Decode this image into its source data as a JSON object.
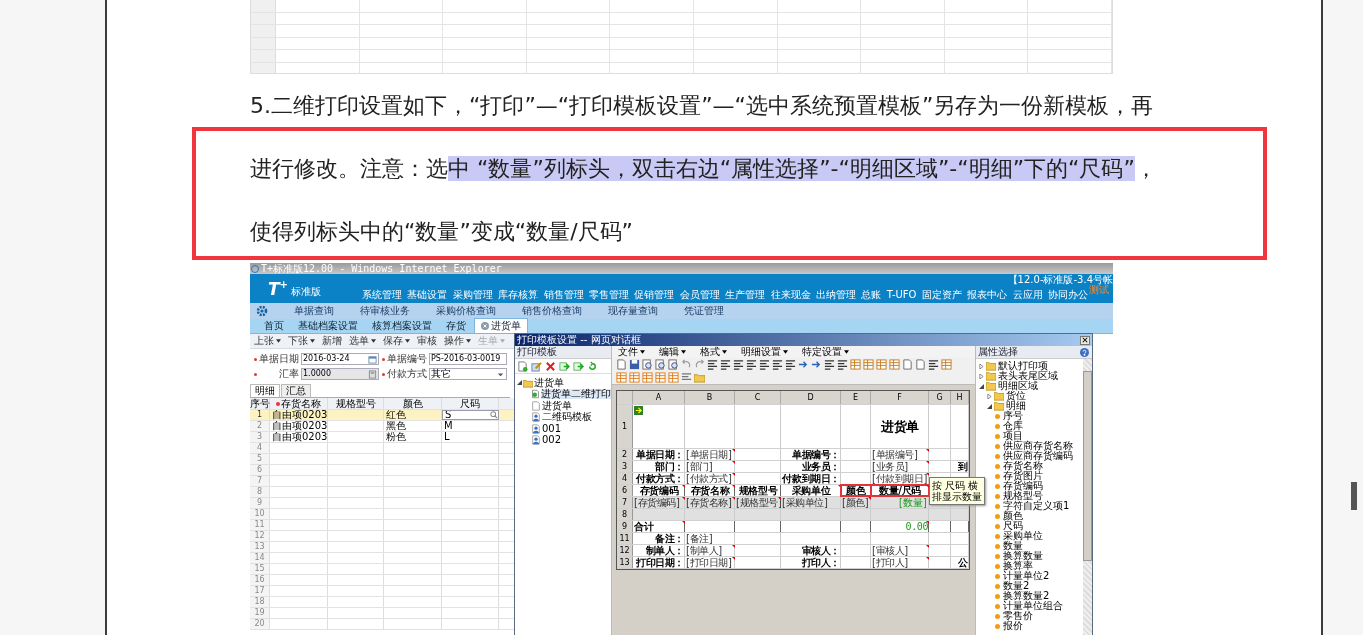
{
  "article": {
    "paragraph_lines": [
      [
        {
          "text": "5.二维打印设置如下，“打印”—“打印模板设置”—“选中系统预置模板”另存为一份新模板，再",
          "highlighted": false
        }
      ],
      [
        {
          "text": "进行修改。注意：选",
          "highlighted": false
        },
        {
          "text": "中 “数量”列标头，双击右边“属性选择”-“明细区域”-“明细”下的“尺码”",
          "highlighted": true
        },
        {
          "text": "，",
          "highlighted": false
        }
      ],
      [
        {
          "text": "使得列标头中的“数量”变成“数量/尺码”",
          "highlighted": false
        }
      ]
    ]
  },
  "screenshot": {
    "window_title": "T+标准版12.00 - Windows Internet Explorer",
    "logo": {
      "mark": "T$^{+}$",
      "edition": "标准版"
    },
    "account": "【12.0-标准版-3.4号帐",
    "nav": [
      {
        "label": "系统管理"
      },
      {
        "label": "基础设置"
      },
      {
        "label": "采购管理"
      },
      {
        "label": "库存核算"
      },
      {
        "label": "销售管理"
      },
      {
        "label": "零售管理"
      },
      {
        "label": "促销管理"
      },
      {
        "label": "会员管理"
      },
      {
        "label": "生产管理"
      },
      {
        "label": "往来现金"
      },
      {
        "label": "出纳管理"
      },
      {
        "label": "总账"
      },
      {
        "label": "T-UFO"
      },
      {
        "label": "固定资产"
      },
      {
        "label": "报表中心"
      },
      {
        "label": "云应用"
      },
      {
        "label": "协同办公",
        "badge": "测试"
      }
    ],
    "subnav": [
      "单据查询",
      "待审核业务",
      "采购价格查询",
      "销售价格查询",
      "现存量查询",
      "凭证管理"
    ],
    "tabs": [
      {
        "label": "首页",
        "selected": false,
        "closable": false
      },
      {
        "label": "基础档案设置",
        "selected": false,
        "closable": false
      },
      {
        "label": "核算档案设置",
        "selected": false,
        "closable": false
      },
      {
        "label": "存货",
        "selected": false,
        "closable": false
      },
      {
        "label": "进货单",
        "selected": true,
        "closable": true
      }
    ],
    "toolbar": [
      {
        "label": "上张",
        "dropdown": true,
        "disabled": false
      },
      {
        "label": "下张",
        "dropdown": true,
        "disabled": false
      },
      {
        "label": "新增",
        "dropdown": false,
        "disabled": false
      },
      {
        "label": "选单",
        "dropdown": true,
        "disabled": false
      },
      {
        "label": "保存",
        "dropdown": true,
        "disabled": false
      },
      {
        "label": "审核",
        "dropdown": false,
        "disabled": false
      },
      {
        "label": "操作",
        "dropdown": true,
        "disabled": false
      },
      {
        "label": "生单",
        "dropdown": true,
        "disabled": true
      }
    ],
    "form": [
      {
        "label": "单据日期",
        "value": "2016-03-24",
        "kind": "date",
        "required": true,
        "disabled": false
      },
      {
        "label": "单据编号",
        "value": "PS-2016-03-0019",
        "kind": "text",
        "required": true,
        "disabled": false
      },
      {
        "label": "汇率",
        "value": "1.0000",
        "kind": "calc",
        "required": true,
        "disabled": true
      },
      {
        "label": "付款方式",
        "value": "其它",
        "kind": "select",
        "required": true,
        "disabled": false
      }
    ],
    "detail_tabs": [
      {
        "label": "明细",
        "selected": true
      },
      {
        "label": "汇总",
        "selected": false
      }
    ],
    "table": {
      "columns": [
        {
          "label": "序号",
          "required": false
        },
        {
          "label": "存货名称",
          "required": true
        },
        {
          "label": "规格型号",
          "required": false
        },
        {
          "label": "颜色",
          "required": false
        },
        {
          "label": "尺码",
          "required": false
        }
      ],
      "rows": [
        {
          "cells": [
            "1",
            "自由项0203",
            null,
            "红色",
            "S"
          ],
          "selected": true
        },
        {
          "cells": [
            "2",
            "自由项0203",
            null,
            "黑色",
            "M"
          ],
          "selected": false
        },
        {
          "cells": [
            "3",
            "自由项0203",
            null,
            "粉色",
            "L"
          ],
          "selected": false
        },
        {
          "cells": [
            "4",
            null,
            null,
            null,
            null
          ],
          "selected": false
        },
        {
          "cells": [
            "5",
            null,
            null,
            null,
            null
          ],
          "selected": false
        },
        {
          "cells": [
            "6",
            null,
            null,
            null,
            null
          ],
          "selected": false
        },
        {
          "cells": [
            "7",
            null,
            null,
            null,
            null
          ],
          "selected": false
        },
        {
          "cells": [
            "8",
            null,
            null,
            null,
            null
          ],
          "selected": false
        },
        {
          "cells": [
            "9",
            null,
            null,
            null,
            null
          ],
          "selected": false
        },
        {
          "cells": [
            "10",
            null,
            null,
            null,
            null
          ],
          "selected": false
        },
        {
          "cells": [
            "11",
            null,
            null,
            null,
            null
          ],
          "selected": false
        },
        {
          "cells": [
            "12",
            null,
            null,
            null,
            null
          ],
          "selected": false
        },
        {
          "cells": [
            "13",
            null,
            null,
            null,
            null
          ],
          "selected": false
        },
        {
          "cells": [
            "14",
            null,
            null,
            null,
            null
          ],
          "selected": false
        },
        {
          "cells": [
            "15",
            null,
            null,
            null,
            null
          ],
          "selected": false
        },
        {
          "cells": [
            "16",
            null,
            null,
            null,
            null
          ],
          "selected": false
        },
        {
          "cells": [
            "17",
            null,
            null,
            null,
            null
          ],
          "selected": false
        },
        {
          "cells": [
            "18",
            null,
            null,
            null,
            null
          ],
          "selected": false
        },
        {
          "cells": [
            "19",
            null,
            null,
            null,
            null
          ],
          "selected": false
        },
        {
          "cells": [
            "20",
            null,
            null,
            null,
            null
          ],
          "selected": false
        }
      ]
    },
    "dialog": {
      "title": "打印模板设置 -- 网页对话框",
      "templates": {
        "title": "打印模板",
        "tree": [
          {
            "label": "进货单",
            "kind": "folder",
            "selected": false,
            "children": [
              {
                "label": "进货单二维打印",
                "kind": "default",
                "selected": true
              },
              {
                "label": "进货单",
                "kind": "blank",
                "selected": false
              },
              {
                "label": "二维码模板",
                "kind": "custom",
                "selected": false
              },
              {
                "label": "001",
                "kind": "custom",
                "selected": false
              },
              {
                "label": "002",
                "kind": "custom",
                "selected": false
              }
            ]
          }
        ]
      },
      "menu": [
        "文件",
        "编辑",
        "格式",
        "明细设置",
        "特定设置"
      ],
      "sheet": {
        "columns": [
          "A",
          "B",
          "C",
          "D",
          "E",
          "F",
          "G",
          "H"
        ],
        "rows": [
          {
            "number": "1",
            "kind": "title",
            "cells": [
              null,
              null,
              null,
              null,
              null,
              {
                "text": "进货单",
                "kind": "title",
                "flag": false
              }
            ]
          },
          {
            "number": "2",
            "kind": "field",
            "cells": [
              {
                "text": "单据日期：",
                "kind": "label",
                "flag": false
              },
              {
                "text": "[单据日期]",
                "kind": "field",
                "flag": true
              },
              null,
              {
                "text": "单据编号：",
                "kind": "label",
                "flag": false
              },
              null,
              {
                "text": "[单据编号]",
                "kind": "field",
                "flag": true
              }
            ]
          },
          {
            "number": "3",
            "kind": "field",
            "cells": [
              {
                "text": "部门：",
                "kind": "label",
                "flag": false
              },
              {
                "text": "[部门]",
                "kind": "field",
                "flag": true
              },
              null,
              {
                "text": "业务员：",
                "kind": "label",
                "flag": false
              },
              null,
              {
                "text": "[业务员]",
                "kind": "field",
                "flag": true
              },
              null,
              {
                "text": "到",
                "kind": "label",
                "flag": false
              }
            ]
          },
          {
            "number": "4",
            "kind": "field",
            "cells": [
              {
                "text": "付款方式：",
                "kind": "label",
                "flag": false
              },
              {
                "text": "[付款方式]",
                "kind": "field",
                "flag": true
              },
              null,
              {
                "text": "付款到期日：",
                "kind": "label",
                "flag": false
              },
              null,
              {
                "text": "[付款到期日]",
                "kind": "field",
                "flag": true
              }
            ]
          },
          {
            "number": "6",
            "kind": "header",
            "cells": [
              {
                "text": "存货编码",
                "kind": "heading",
                "flag": true,
                "outlined": false
              },
              {
                "text": "存货名称",
                "kind": "heading",
                "flag": true,
                "outlined": false
              },
              {
                "text": "规格型号",
                "kind": "heading",
                "flag": false,
                "outlined": false
              },
              {
                "text": "采购单位",
                "kind": "heading",
                "flag": true,
                "outlined": false
              },
              {
                "text": "颜色",
                "kind": "heading",
                "flag": false,
                "outlined": true
              },
              {
                "text": "数量/尺码",
                "kind": "heading",
                "flag": true,
                "outlined": true
              }
            ]
          },
          {
            "number": "7",
            "kind": "data",
            "cells": [
              {
                "text": "[存货编码]",
                "kind": "field",
                "flag": true
              },
              {
                "text": "[存货名称]",
                "kind": "field",
                "flag": true
              },
              {
                "text": "[规格型号]",
                "kind": "field",
                "flag": true
              },
              {
                "text": "[采购单位]",
                "kind": "field",
                "flag": false
              },
              {
                "text": "[颜色]",
                "kind": "field",
                "flag": true
              },
              {
                "text": "[数量]",
                "kind": "amount",
                "flag": false
              }
            ]
          },
          {
            "number": "8",
            "kind": "blank"
          },
          {
            "number": "9",
            "kind": "total",
            "cells": [
              {
                "text": "合计",
                "kind": "text",
                "flag": true
              },
              null,
              null,
              null,
              null,
              {
                "text": "0.00",
                "kind": "amount",
                "flag": true
              }
            ]
          },
          {
            "number": "11",
            "kind": "field",
            "cells": [
              {
                "text": "备注：",
                "kind": "label",
                "flag": false
              },
              {
                "text": "[备注]",
                "kind": "field",
                "flag": false
              }
            ]
          },
          {
            "number": "12",
            "kind": "field",
            "cells": [
              {
                "text": "制单人：",
                "kind": "label",
                "flag": false
              },
              {
                "text": "[制单人]",
                "kind": "field",
                "flag": true
              },
              null,
              {
                "text": "审核人：",
                "kind": "label",
                "flag": false
              },
              null,
              {
                "text": "[审核人]",
                "kind": "field",
                "flag": true
              }
            ]
          },
          {
            "number": "13",
            "kind": "field",
            "cells": [
              {
                "text": "打印日期：",
                "kind": "label",
                "flag": false
              },
              {
                "text": "[打印日期]",
                "kind": "field",
                "flag": true
              },
              null,
              {
                "text": "打印人：",
                "kind": "label",
                "flag": false
              },
              null,
              {
                "text": "[打印人]",
                "kind": "field",
                "flag": true
              },
              null,
              {
                "text": "公",
                "kind": "label",
                "flag": false
              }
            ]
          }
        ]
      },
      "tooltip": "按 尺码 横排显示数量",
      "properties": {
        "title": "属性选择",
        "tree": [
          {
            "label": "默认打印项",
            "kind": "folder",
            "expanded": false
          },
          {
            "label": "表头表尾区域",
            "kind": "folder",
            "expanded": false
          },
          {
            "label": "明细区域",
            "kind": "folder",
            "expanded": true,
            "children": [
              {
                "label": "货位",
                "kind": "folder",
                "expanded": false
              },
              {
                "label": "明细",
                "kind": "folder",
                "expanded": true,
                "children": [
                  {
                    "label": "序号",
                    "kind": "field"
                  },
                  {
                    "label": "仓库",
                    "kind": "field"
                  },
                  {
                    "label": "项目",
                    "kind": "field"
                  },
                  {
                    "label": "供应商存货名称",
                    "kind": "field"
                  },
                  {
                    "label": "供应商存货编码",
                    "kind": "field"
                  },
                  {
                    "label": "存货名称",
                    "kind": "field"
                  },
                  {
                    "label": "存货图片",
                    "kind": "field"
                  },
                  {
                    "label": "存货编码",
                    "kind": "field"
                  },
                  {
                    "label": "规格型号",
                    "kind": "field"
                  },
                  {
                    "label": "字符自定义项1",
                    "kind": "field"
                  },
                  {
                    "label": "颜色",
                    "kind": "field"
                  },
                  {
                    "label": "尺码",
                    "kind": "field"
                  },
                  {
                    "label": "采购单位",
                    "kind": "field"
                  },
                  {
                    "label": "数量",
                    "kind": "field"
                  },
                  {
                    "label": "换算数量",
                    "kind": "field"
                  },
                  {
                    "label": "换算率",
                    "kind": "field"
                  },
                  {
                    "label": "计量单位2",
                    "kind": "field"
                  },
                  {
                    "label": "数量2",
                    "kind": "field"
                  },
                  {
                    "label": "换算数量2",
                    "kind": "field"
                  },
                  {
                    "label": "计量单位组合",
                    "kind": "field"
                  },
                  {
                    "label": "零售价",
                    "kind": "field"
                  },
                  {
                    "label": "报价",
                    "kind": "field"
                  }
                ]
              }
            ]
          }
        ]
      }
    }
  }
}
